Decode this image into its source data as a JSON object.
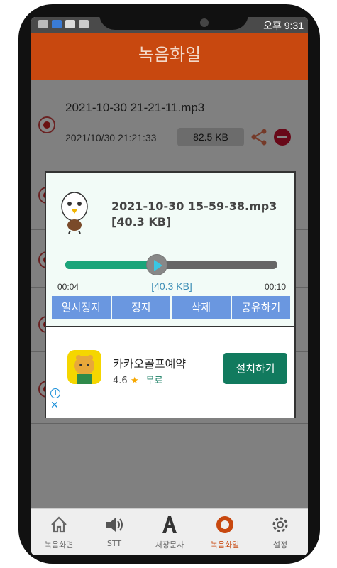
{
  "status": {
    "carrier_time": "오후 9:31"
  },
  "header": {
    "title": "녹음화일"
  },
  "list": {
    "items": [
      {
        "name": "2021-10-30 21-21-11.mp3",
        "date": "2021/10/30 21:21:33",
        "size": "82.5  KB"
      }
    ]
  },
  "dialog": {
    "title": "2021-10-30 15-59-38.mp3",
    "size": "[40.3  KB]",
    "progress": 0.43,
    "time_start": "00:04",
    "size_mid": "[40.3  KB]",
    "time_end": "00:10",
    "buttons": [
      "일시정지",
      "정지",
      "삭제",
      "공유하기"
    ]
  },
  "ad": {
    "title": "카카오골프예약",
    "rating": "4.6",
    "star": "★",
    "free": "무료",
    "install": "설치하기",
    "info": "i",
    "close": "✕"
  },
  "nav": {
    "items": [
      {
        "label": "녹음화면",
        "icon": "home-icon"
      },
      {
        "label": "STT",
        "icon": "speaker-icon"
      },
      {
        "label": "저장문자",
        "icon": "letter-a-icon"
      },
      {
        "label": "녹음화일",
        "icon": "record-icon",
        "active": true
      },
      {
        "label": "설정",
        "icon": "gear-icon"
      }
    ]
  },
  "colors": {
    "header": "#c8480f",
    "accent": "#1aa57a",
    "button": "#6a97e0",
    "install": "#117a5e"
  }
}
